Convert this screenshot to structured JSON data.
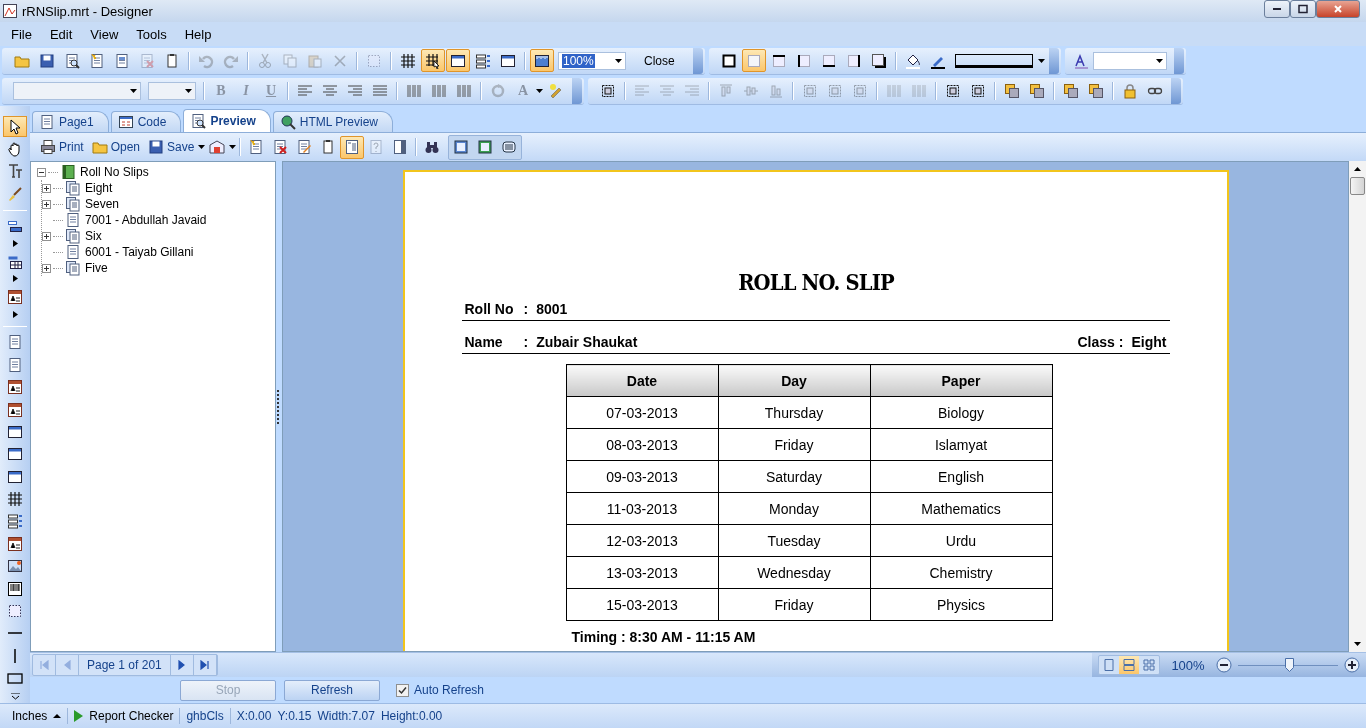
{
  "window": {
    "title": "rRNSlip.mrt - Designer"
  },
  "menu": [
    "File",
    "Edit",
    "View",
    "Tools",
    "Help"
  ],
  "main_toolbar": {
    "buttons": [
      {
        "on": false,
        "disabled": false
      },
      {
        "on": false,
        "disabled": false
      },
      {
        "on": false,
        "disabled": false
      },
      {
        "on": false,
        "disabled": false
      },
      {
        "on": false,
        "disabled": false
      },
      {
        "on": false,
        "disabled": true
      },
      {
        "on": false,
        "disabled": false
      },
      {
        "on": false,
        "disabled": true
      },
      {
        "on": false,
        "disabled": true
      },
      {
        "on": false,
        "disabled": true
      },
      {
        "on": false,
        "disabled": true
      },
      {
        "on": false,
        "disabled": true
      },
      {
        "on": false,
        "disabled": true
      },
      {
        "on": false,
        "disabled": true
      },
      {
        "on": false,
        "disabled": false
      },
      {
        "on": true,
        "disabled": false
      },
      {
        "on": true,
        "disabled": false
      },
      {
        "on": false,
        "disabled": false
      },
      {
        "on": false,
        "disabled": false
      },
      {
        "on": true,
        "disabled": false
      }
    ],
    "zoom_field": {
      "value": "100%"
    },
    "close_button": {
      "label": "Close"
    }
  },
  "border_toolbar": {
    "buttons": [
      {
        "on": false,
        "disabled": false
      },
      {
        "on": true,
        "disabled": false
      },
      {
        "on": false,
        "disabled": false
      },
      {
        "on": false,
        "disabled": false
      },
      {
        "on": false,
        "disabled": false
      },
      {
        "on": false,
        "disabled": false
      },
      {
        "on": false,
        "disabled": false
      },
      {
        "on": false,
        "disabled": false
      },
      {
        "on": false,
        "disabled": false
      }
    ]
  },
  "format_toolbar": {
    "text_buttons": [
      {
        "text": "B",
        "disabled": true
      },
      {
        "text": "I",
        "disabled": true
      },
      {
        "text": "U",
        "disabled": true
      },
      {
        "text": "A",
        "disabled": true
      }
    ],
    "buttons": [
      {
        "on": false,
        "disabled": false
      },
      {
        "on": false,
        "disabled": false
      },
      {
        "on": false,
        "disabled": false
      },
      {
        "on": false,
        "disabled": false
      },
      {
        "on": false,
        "disabled": false
      },
      {
        "on": false,
        "disabled": false
      },
      {
        "on": false,
        "disabled": false
      },
      {
        "on": false,
        "disabled": true
      },
      {
        "on": false,
        "disabled": false
      }
    ]
  },
  "layout_toolbar": {
    "buttons": [
      {
        "on": false,
        "disabled": false
      },
      {
        "on": false,
        "disabled": true
      },
      {
        "on": false,
        "disabled": true
      },
      {
        "on": false,
        "disabled": true
      },
      {
        "on": false,
        "disabled": true
      },
      {
        "on": false,
        "disabled": true
      },
      {
        "on": false,
        "disabled": true
      },
      {
        "on": false,
        "disabled": true
      },
      {
        "on": false,
        "disabled": true
      },
      {
        "on": false,
        "disabled": true
      },
      {
        "on": false,
        "disabled": true
      },
      {
        "on": false,
        "disabled": true
      },
      {
        "on": false,
        "disabled": false
      },
      {
        "on": false,
        "disabled": false
      },
      {
        "on": false,
        "disabled": false
      },
      {
        "on": false,
        "disabled": false
      },
      {
        "on": false,
        "disabled": false
      },
      {
        "on": false,
        "disabled": false
      },
      {
        "on": false,
        "disabled": false
      },
      {
        "on": false,
        "disabled": false
      }
    ]
  },
  "toolbox": [
    {
      "selected": true
    },
    {
      "selected": false
    },
    {
      "selected": false
    },
    {
      "selected": false
    },
    {
      "selected": false
    },
    {
      "selected": false
    },
    {
      "selected": false
    },
    {
      "selected": false
    },
    {
      "selected": false
    },
    {
      "selected": false
    },
    {
      "selected": false
    },
    {
      "selected": false
    },
    {
      "selected": false
    },
    {
      "selected": false
    },
    {
      "selected": false
    },
    {
      "selected": false
    },
    {
      "selected": false
    },
    {
      "selected": false
    },
    {
      "selected": false
    },
    {
      "selected": false
    },
    {
      "selected": false
    },
    {
      "selected": false
    },
    {
      "selected": false
    }
  ],
  "tabs": [
    {
      "label": "Page1",
      "selected": false
    },
    {
      "label": "Code",
      "selected": false
    },
    {
      "label": "Preview",
      "selected": true
    },
    {
      "label": "HTML Preview",
      "selected": false
    }
  ],
  "preview_toolbar": {
    "print": "Print",
    "open": "Open",
    "save": "Save",
    "buttons": [
      {
        "on": false,
        "disabled": false
      },
      {
        "on": false,
        "disabled": false
      },
      {
        "on": false,
        "disabled": false
      },
      {
        "on": false,
        "disabled": false
      },
      {
        "on": false,
        "disabled": false
      },
      {
        "on": true,
        "disabled": false
      },
      {
        "on": false,
        "disabled": true
      },
      {
        "on": false,
        "disabled": false
      },
      {
        "on": false,
        "disabled": false
      },
      {
        "on": false,
        "disabled": false
      },
      {
        "on": false,
        "disabled": false
      },
      {
        "on": false,
        "disabled": false
      }
    ]
  },
  "tree": [
    {
      "label": "Roll No Slips",
      "kind": "book",
      "expanded": true,
      "children": [
        {
          "label": "Eight",
          "kind": "group",
          "expanded": false
        },
        {
          "label": "Seven",
          "kind": "group",
          "expanded": false
        },
        {
          "label": "7001 - Abdullah Javaid",
          "kind": "item"
        },
        {
          "label": "Six",
          "kind": "group",
          "expanded": false
        },
        {
          "label": "6001 - Taiyab Gillani",
          "kind": "item"
        },
        {
          "label": "Five",
          "kind": "group",
          "expanded": false
        }
      ]
    }
  ],
  "report": {
    "title": "ROLL NO. SLIP",
    "roll": {
      "label": "Roll No",
      "separator": ":",
      "value": "8001"
    },
    "name": {
      "label": "Name",
      "separator": ":",
      "value": "Zubair Shaukat"
    },
    "class": {
      "label": "Class",
      "separator": ":",
      "value": "Eight"
    },
    "table": {
      "columns": [
        "Date",
        "Day",
        "Paper"
      ],
      "rows": [
        [
          "07-03-2013",
          "Thursday",
          "Biology"
        ],
        [
          "08-03-2013",
          "Friday",
          "Islamyat"
        ],
        [
          "09-03-2013",
          "Saturday",
          "English"
        ],
        [
          "11-03-2013",
          "Monday",
          "Mathematics"
        ],
        [
          "12-03-2013",
          "Tuesday",
          "Urdu"
        ],
        [
          "13-03-2013",
          "Wednesday",
          "Chemistry"
        ],
        [
          "15-03-2013",
          "Friday",
          "Physics"
        ]
      ]
    },
    "timing": "Timing : 8:30 AM - 11:15 AM"
  },
  "pager": {
    "label": "Page 1 of 201",
    "buttons": [
      {
        "disabled": true
      },
      {
        "disabled": true
      },
      {
        "disabled": false
      },
      {
        "disabled": false
      }
    ]
  },
  "zoom_bar": {
    "modes": [
      {
        "selected": false
      },
      {
        "selected": true
      },
      {
        "selected": false
      }
    ],
    "reading": "100%",
    "level": 0.52
  },
  "actions": {
    "stop": {
      "label": "Stop",
      "disabled": true
    },
    "refresh": {
      "label": "Refresh",
      "disabled": false
    },
    "auto_refresh": {
      "label": "Auto Refresh",
      "checked": true
    }
  },
  "status_bar": {
    "units": "Inches",
    "checker": "Report Checker",
    "component": "ghbCls",
    "x": "X:0.00",
    "y": "Y:0.15",
    "width": "Width:7.07",
    "height": "Height:0.00"
  }
}
